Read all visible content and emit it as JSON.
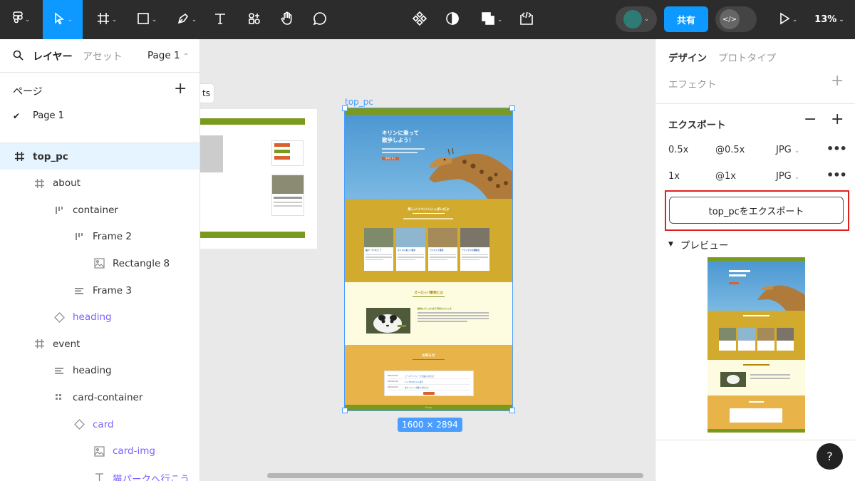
{
  "toolbar": {
    "share_label": "共有",
    "zoom": "13%"
  },
  "left_panel": {
    "tabs": {
      "layers": "レイヤー",
      "assets": "アセット"
    },
    "page_selector": "Page 1",
    "pages_title": "ページ",
    "pages": [
      {
        "name": "Page 1",
        "selected": true
      }
    ],
    "layers": [
      {
        "name": "top_pc",
        "icon": "frame",
        "depth": 0,
        "selected": true
      },
      {
        "name": "about",
        "icon": "frame",
        "depth": 1
      },
      {
        "name": "container",
        "icon": "autolayout-h",
        "depth": 2
      },
      {
        "name": "Frame 2",
        "icon": "autolayout-h",
        "depth": 3
      },
      {
        "name": "Rectangle 8",
        "icon": "image",
        "depth": 4
      },
      {
        "name": "Frame 3",
        "icon": "autolayout-v",
        "depth": 3
      },
      {
        "name": "heading",
        "icon": "component",
        "depth": 2,
        "purple": true
      },
      {
        "name": "event",
        "icon": "frame",
        "depth": 1
      },
      {
        "name": "heading",
        "icon": "autolayout-v",
        "depth": 2
      },
      {
        "name": "card-container",
        "icon": "grid",
        "depth": 2
      },
      {
        "name": "card",
        "icon": "component",
        "depth": 3,
        "purple": true
      },
      {
        "name": "card-img",
        "icon": "image",
        "depth": 4,
        "purple": true
      },
      {
        "name": "猫パークへ行こう",
        "icon": "text",
        "depth": 4,
        "purple": true
      }
    ]
  },
  "canvas": {
    "left_frame_label_fragment": "ts",
    "frame_label": "top_pc",
    "size_badge": "1600 × 2894",
    "site": {
      "hero_title": "キリンに乗って\n散歩しよう！",
      "hero_button": "詳細を見る",
      "event_heading": "楽しいイベントいっぱいだよ",
      "cards": [
        {
          "title": "猫パークへ行こう"
        },
        {
          "title": "キリンに乗って散歩"
        },
        {
          "title": "ライオンと散歩"
        },
        {
          "title": "アライグマの運動会"
        }
      ],
      "about_heading": "ズーロッパ動物とは",
      "about_sub": "動物たちとふれあう特別なひととき",
      "news_heading": "お知らせ",
      "news": [
        {
          "date": "2024.05.01",
          "text": "ゴールデンウィーク営業のお知らせ"
        },
        {
          "date": "2024.04.20",
          "text": "パンダの赤ちゃん誕生"
        },
        {
          "date": "2024.04.01",
          "text": "春のイベント開催のお知らせ"
        }
      ],
      "footer": "© zoo"
    }
  },
  "right_panel": {
    "tabs": {
      "design": "デザイン",
      "prototype": "プロトタイプ"
    },
    "effects_label": "エフェクト",
    "export_label": "エクスポート",
    "exports": [
      {
        "scale": "0.5x",
        "suffix": "@0.5x",
        "format": "JPG"
      },
      {
        "scale": "1x",
        "suffix": "@1x",
        "format": "JPG"
      }
    ],
    "export_button": "top_pcをエクスポート",
    "preview_label": "プレビュー"
  },
  "colors": {
    "accent": "#0d99ff",
    "highlight": "#e02020",
    "site_green": "#7a9a1e",
    "site_mustard": "#d2ab2e",
    "site_cream": "#fdfbe0",
    "site_orange": "#e8b44a",
    "sky": "#5aa7d8"
  }
}
